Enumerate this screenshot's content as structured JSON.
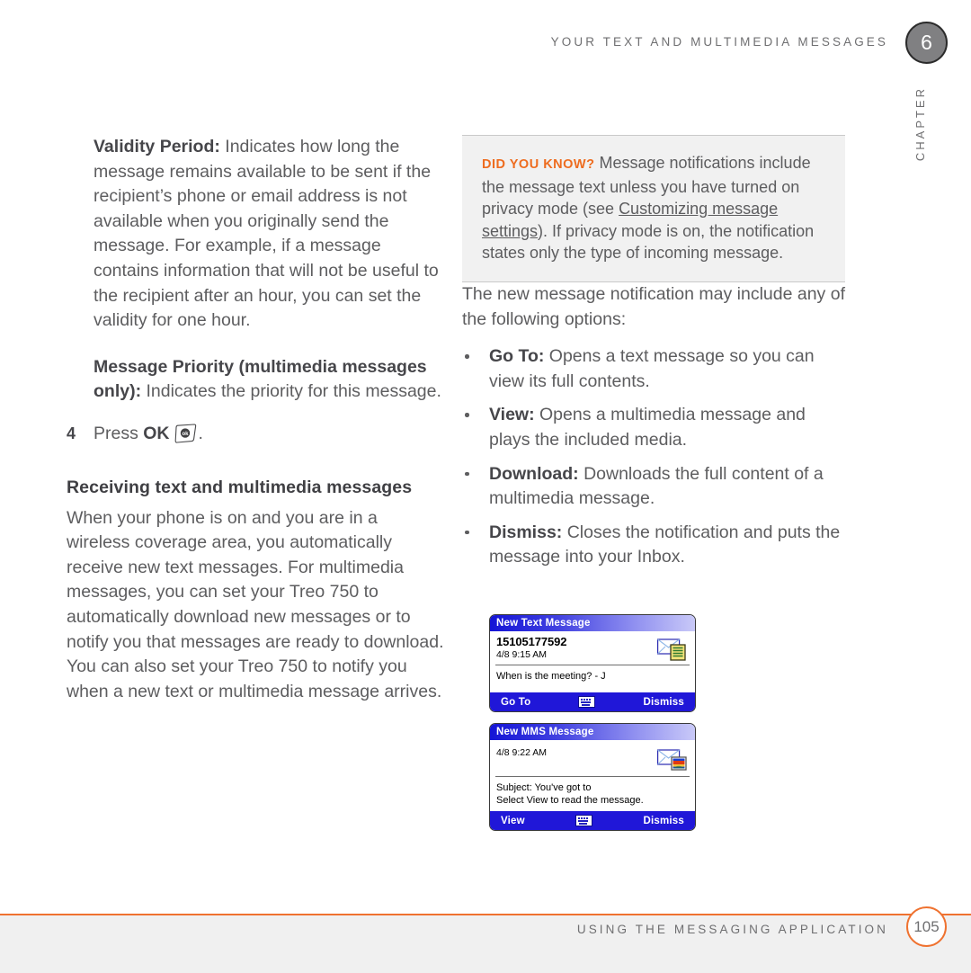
{
  "header": {
    "title": "YOUR TEXT AND MULTIMEDIA MESSAGES",
    "chapter_number": "6",
    "chapter_label": "CHAPTER"
  },
  "left_column": {
    "para_validity": {
      "term": "Validity Period:",
      "text": " Indicates how long the message remains available to be sent if the recipient’s phone or email address is not available when you originally send the message. For example, if a message contains information that will not be useful to the recipient after an hour, you can set the validity for one hour."
    },
    "para_priority": {
      "term": "Message Priority (multimedia messages only):",
      "text": " Indicates the priority for this message."
    },
    "step": {
      "number": "4",
      "text_before": "Press ",
      "key_label": "OK",
      "key_icon_text": "ok",
      "text_after": "."
    },
    "subheading": "Receiving text and multimedia messages",
    "para_receiving": "When your phone is on and you are in a wireless coverage area, you automatically receive new text messages. For multimedia messages, you can set your Treo 750 to automatically download new messages or to notify you that messages are ready to download. You can also set your Treo 750 to notify you when a new text or multimedia message arrives."
  },
  "right_column": {
    "callout": {
      "label": "DID YOU KNOW?",
      "text_before_link": " Message notifications include the message text unless you have turned on privacy mode (see ",
      "link_text": "Customizing message settings",
      "text_after_link": "). If privacy mode is on, the notification states only the type of incoming message."
    },
    "intro": "The new message notification may include any of the following options:",
    "bullets": [
      {
        "term": "Go To:",
        "text": " Opens a text message so you can view its full contents."
      },
      {
        "term": "View:",
        "text": " Opens a multimedia message and plays the included media."
      },
      {
        "term": "Download:",
        "text": " Downloads the full content of a multimedia message."
      },
      {
        "term": "Dismiss:",
        "text": " Closes the notification and puts the message into your Inbox."
      }
    ],
    "screenshots": [
      {
        "title": "New Text Message",
        "from": "15105177592",
        "time": "4/8 9:15 AM",
        "message": "When is the meeting? - J",
        "softkey_left": "Go To",
        "softkey_right": "Dismiss",
        "icon": "envelope-text-icon"
      },
      {
        "title": "New MMS Message",
        "from": "",
        "time": "4/8 9:22 AM",
        "message": "Subject: You've got to\nSelect View to read the message.",
        "softkey_left": "View",
        "softkey_right": "Dismiss",
        "icon": "envelope-mms-icon"
      }
    ]
  },
  "footer": {
    "title": "USING THE MESSAGING APPLICATION",
    "page_number": "105"
  },
  "colors": {
    "accent_orange": "#ef7230",
    "callout_label_orange": "#ee6c1f",
    "body_gray": "#5d5d5f",
    "chapter_badge_gray": "#808082",
    "screen_blue": "#2017d8"
  }
}
